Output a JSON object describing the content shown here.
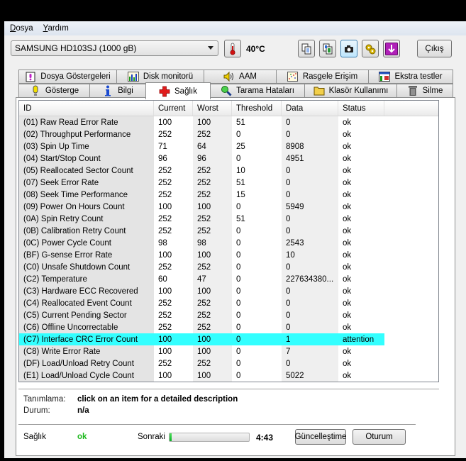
{
  "menu": {
    "items": [
      {
        "label": "Dosya",
        "accel": "D",
        "rest": "osya"
      },
      {
        "label": "Yardım",
        "accel": "Y",
        "rest": "ardım"
      }
    ]
  },
  "toolbar": {
    "drive_select": "SAMSUNG HD103SJ (1000 gB)",
    "temperature": "40°C",
    "buttons": [
      "copy-text-icon",
      "copy-image-icon",
      "screenshot-camera-icon",
      "options-gear-icon",
      "download-arrow-icon"
    ],
    "exit_label": "Çıkış"
  },
  "tabs": {
    "row1": [
      {
        "label": "Dosya Göstergeleri",
        "icon": "file-info-icon"
      },
      {
        "label": "Disk monitorü",
        "icon": "chart-icon"
      },
      {
        "label": "AAM",
        "icon": "speaker-icon"
      },
      {
        "label": "Rasgele Erişim",
        "icon": "scatter-icon"
      },
      {
        "label": "Ekstra testler",
        "icon": "extra-tests-icon"
      }
    ],
    "row2": [
      {
        "label": "Gösterge",
        "icon": "lightbulb-icon"
      },
      {
        "label": "Bilgi",
        "icon": "info-icon"
      },
      {
        "label": "Sağlık",
        "icon": "health-cross-icon",
        "selected": true
      },
      {
        "label": "Tarama Hataları",
        "icon": "magnifier-icon"
      },
      {
        "label": "Klasör Kullanımı",
        "icon": "folder-icon"
      },
      {
        "label": "Silme",
        "icon": "trash-icon"
      }
    ]
  },
  "smart_table": {
    "columns": [
      "ID",
      "Current",
      "Worst",
      "Threshold",
      "Data",
      "Status"
    ],
    "rows": [
      [
        "(01) Raw Read Error Rate",
        "100",
        "100",
        "51",
        "0",
        "ok"
      ],
      [
        "(02) Throughput Performance",
        "252",
        "252",
        "0",
        "0",
        "ok"
      ],
      [
        "(03) Spin Up Time",
        "71",
        "64",
        "25",
        "8908",
        "ok"
      ],
      [
        "(04) Start/Stop Count",
        "96",
        "96",
        "0",
        "4951",
        "ok"
      ],
      [
        "(05) Reallocated Sector Count",
        "252",
        "252",
        "10",
        "0",
        "ok"
      ],
      [
        "(07) Seek Error Rate",
        "252",
        "252",
        "51",
        "0",
        "ok"
      ],
      [
        "(08) Seek Time Performance",
        "252",
        "252",
        "15",
        "0",
        "ok"
      ],
      [
        "(09) Power On Hours Count",
        "100",
        "100",
        "0",
        "5949",
        "ok"
      ],
      [
        "(0A) Spin Retry Count",
        "252",
        "252",
        "51",
        "0",
        "ok"
      ],
      [
        "(0B) Calibration Retry Count",
        "252",
        "252",
        "0",
        "0",
        "ok"
      ],
      [
        "(0C) Power Cycle Count",
        "98",
        "98",
        "0",
        "2543",
        "ok"
      ],
      [
        "(BF) G-sense Error Rate",
        "100",
        "100",
        "0",
        "10",
        "ok"
      ],
      [
        "(C0) Unsafe Shutdown Count",
        "252",
        "252",
        "0",
        "0",
        "ok"
      ],
      [
        "(C2) Temperature",
        "60",
        "47",
        "0",
        "227634380...",
        "ok"
      ],
      [
        "(C3) Hardware ECC Recovered",
        "100",
        "100",
        "0",
        "0",
        "ok"
      ],
      [
        "(C4) Reallocated Event Count",
        "252",
        "252",
        "0",
        "0",
        "ok"
      ],
      [
        "(C5) Current Pending Sector",
        "252",
        "252",
        "0",
        "0",
        "ok"
      ],
      [
        "(C6) Offline Uncorrectable",
        "252",
        "252",
        "0",
        "0",
        "ok"
      ],
      [
        "(C7) Interface CRC Error Count",
        "100",
        "100",
        "0",
        "1",
        "attention"
      ],
      [
        "(C8) Write Error Rate",
        "100",
        "100",
        "0",
        "7",
        "ok"
      ],
      [
        "(DF) Load/Unload Retry Count",
        "252",
        "252",
        "0",
        "0",
        "ok"
      ],
      [
        "(E1) Load/Unload Cycle Count",
        "100",
        "100",
        "0",
        "5022",
        "ok"
      ]
    ],
    "highlight_color": "#33ffff"
  },
  "details": {
    "description_label": "Tanımlama:",
    "description_value": "click on an item for a detailed description",
    "status_label": "Durum:",
    "status_value": "n/a"
  },
  "footer": {
    "health_label": "Sağlık",
    "health_value": "ok",
    "health_color": "#1cb81c",
    "next_label": "Sonraki",
    "next_progress_fraction": 0.03,
    "timer": "4:43",
    "refresh_button": "Güncelleştime",
    "log_button": "Oturum"
  }
}
